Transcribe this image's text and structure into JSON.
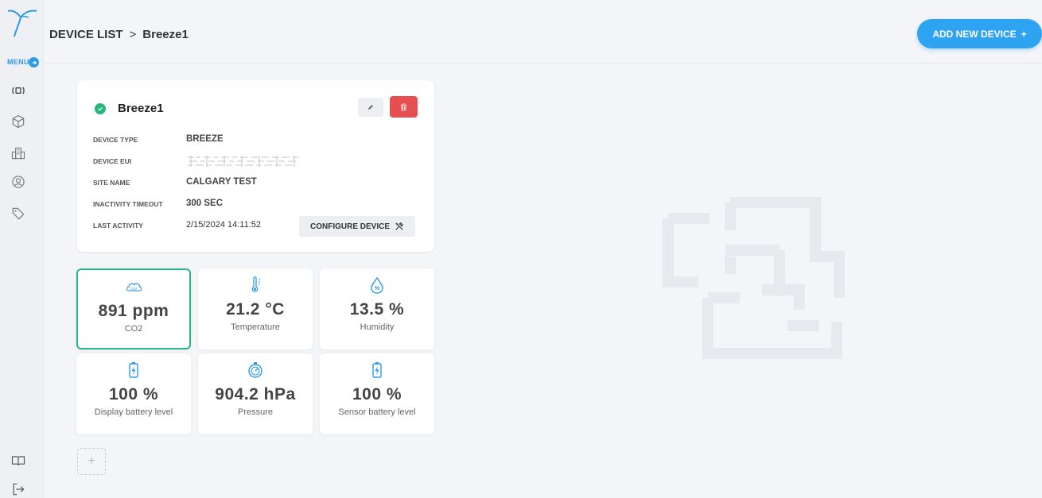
{
  "sidebar": {
    "menu_label": "MENU",
    "items": [
      {
        "icon": "device-signal-icon",
        "label": "((□))"
      },
      {
        "icon": "cube-icon"
      },
      {
        "icon": "buildings-icon"
      },
      {
        "icon": "user-circle-icon"
      },
      {
        "icon": "tag-icon"
      }
    ],
    "bottom": [
      {
        "icon": "book-icon"
      },
      {
        "icon": "logout-icon"
      }
    ]
  },
  "header": {
    "breadcrumb_root": "DEVICE LIST",
    "breadcrumb_sep": ">",
    "breadcrumb_current": "Breeze1",
    "add_button_label": "ADD NEW DEVICE",
    "add_button_icon": "+"
  },
  "device": {
    "name": "Breeze1",
    "status": "online",
    "info": [
      {
        "label": "DEVICE TYPE",
        "value": "BREEZE"
      },
      {
        "label": "DEVICE EUI",
        "value": ""
      },
      {
        "label": "SITE NAME",
        "value": "CALGARY TEST"
      },
      {
        "label": "INACTIVITY TIMEOUT",
        "value": "300 SEC"
      },
      {
        "label": "LAST ACTIVITY",
        "value": "2/15/2024 14:11:52"
      }
    ],
    "configure_label": "CONFIGURE DEVICE"
  },
  "tiles": [
    {
      "icon": "co2-cloud-icon",
      "icon_text": "CO2",
      "value": "891 ppm",
      "label": "CO2",
      "selected": true
    },
    {
      "icon": "thermometer-icon",
      "value": "21.2 °C",
      "label": "Temperature"
    },
    {
      "icon": "humidity-drop-icon",
      "icon_text": "%",
      "value": "13.5 %",
      "label": "Humidity"
    },
    {
      "icon": "battery-charging-icon",
      "value": "100 %",
      "label": "Display battery level"
    },
    {
      "icon": "pressure-gauge-icon",
      "value": "904.2 hPa",
      "label": "Pressure"
    },
    {
      "icon": "battery-charging-icon",
      "value": "100 %",
      "label": "Sensor battery level"
    }
  ],
  "add_tile_label": "+",
  "colors": {
    "accent": "#2ea3f2",
    "status_ok": "#25b67d",
    "danger": "#e64f4f",
    "selected_border": "#2cb58b",
    "icon_blue": "#2c9be3"
  }
}
